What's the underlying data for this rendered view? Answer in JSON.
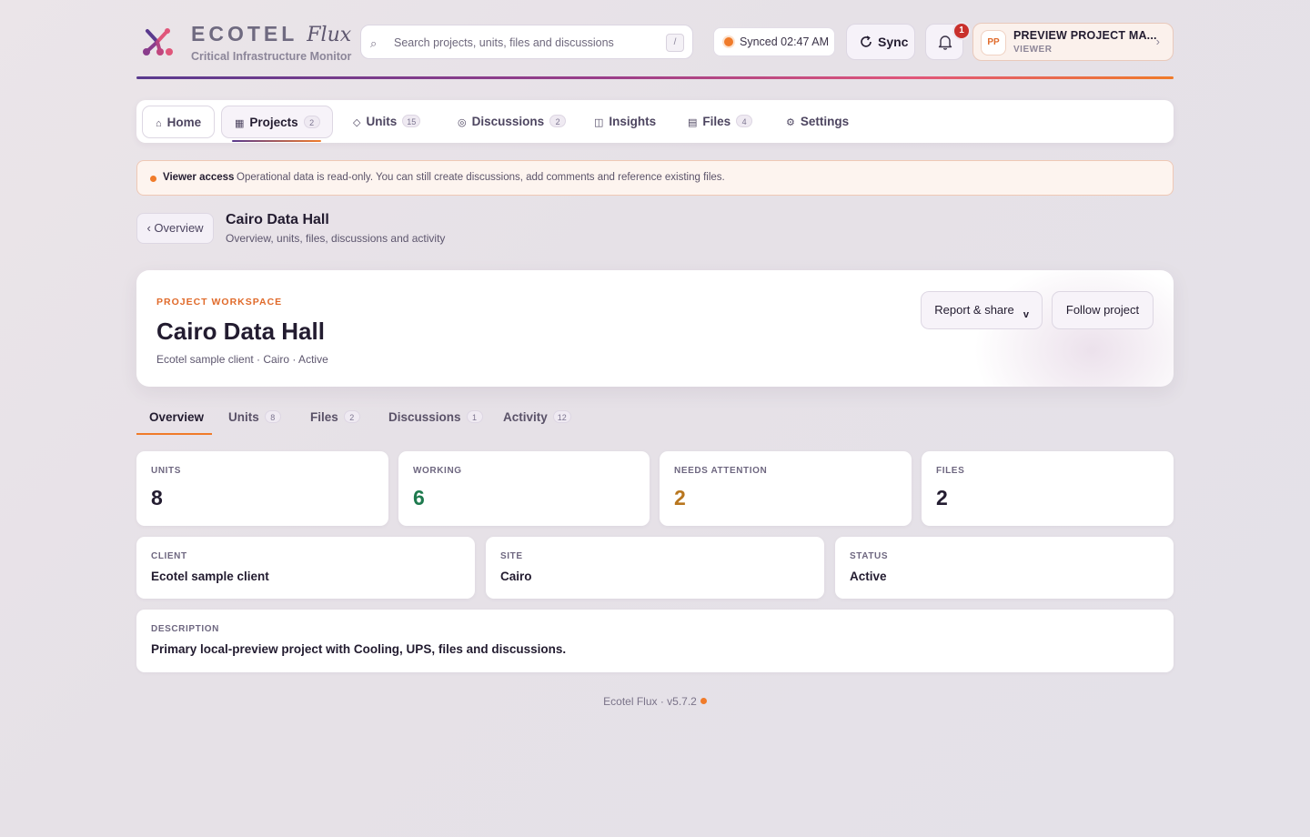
{
  "brand": {
    "name": "ECOTEL",
    "product": "Flux",
    "tagline": "Critical Infrastructure Monitor"
  },
  "search": {
    "placeholder": "Search projects, units, files and discussions",
    "shortcut": "/"
  },
  "sync": {
    "status": "Synced 02:47 AM",
    "button_label": "Sync"
  },
  "notifications": {
    "count": "1"
  },
  "profile": {
    "initials": "PP",
    "name": "PREVIEW PROJECT MA...",
    "role": "VIEWER"
  },
  "nav": {
    "home": "Home",
    "projects": {
      "label": "Projects",
      "count": "2"
    },
    "units": {
      "label": "Units",
      "count": "15"
    },
    "discussions": {
      "label": "Discussions",
      "count": "2"
    },
    "insights": "Insights",
    "files": {
      "label": "Files",
      "count": "4"
    },
    "settings": "Settings"
  },
  "banner": {
    "title": "Viewer access",
    "text": "Operational data is read-only. You can still create discussions, add comments and reference existing files."
  },
  "page": {
    "back_label": "‹ Overview",
    "title": "Cairo Data Hall",
    "subtitle": "Overview, units, files, discussions and activity"
  },
  "workspace": {
    "kicker": "PROJECT WORKSPACE",
    "title": "Cairo Data Hall",
    "meta": "Ecotel sample client · Cairo · Active",
    "report_label": "Report & share",
    "follow_label": "Follow project"
  },
  "tabs": {
    "overview": "Overview",
    "units": {
      "label": "Units",
      "count": "8"
    },
    "files": {
      "label": "Files",
      "count": "2"
    },
    "discussions": {
      "label": "Discussions",
      "count": "1"
    },
    "activity": {
      "label": "Activity",
      "count": "12"
    }
  },
  "stats": {
    "units": {
      "label": "UNITS",
      "value": "8"
    },
    "working": {
      "label": "WORKING",
      "value": "6"
    },
    "attention": {
      "label": "NEEDS ATTENTION",
      "value": "2"
    },
    "files": {
      "label": "FILES",
      "value": "2"
    }
  },
  "info": {
    "client": {
      "label": "CLIENT",
      "value": "Ecotel sample client"
    },
    "site": {
      "label": "SITE",
      "value": "Cairo"
    },
    "status": {
      "label": "STATUS",
      "value": "Active"
    }
  },
  "description": {
    "label": "DESCRIPTION",
    "value": "Primary local-preview project with Cooling, UPS, files and discussions."
  },
  "footer": {
    "text": "Ecotel Flux ·  v5.7.2"
  },
  "colors": {
    "accent": "#f07b2a",
    "brand_purple": "#5a3a8e",
    "working": "#1e7a4e",
    "attention": "#b8761e",
    "neutral_value": "#231c30"
  },
  "icons": {
    "logo": "ecotel-network-logo",
    "search": "search-icon",
    "sync": "refresh-icon",
    "bell": "bell-icon",
    "chevron": "chevron-right-icon"
  }
}
